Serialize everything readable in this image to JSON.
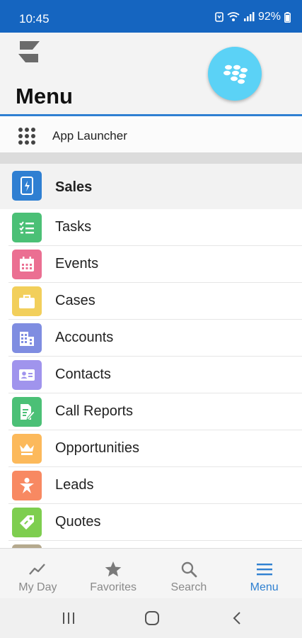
{
  "status_bar": {
    "time": "10:45",
    "battery": "92%",
    "icons": [
      "nfc-icon",
      "wifi-icon",
      "signal-icon",
      "battery-icon"
    ]
  },
  "header": {
    "title": "Menu",
    "logo_icon": "s-logo-icon",
    "fab_icon": "blackberry-logo-icon",
    "fab_color": "#5bd2f6"
  },
  "app_launcher": {
    "label": "App Launcher",
    "icon": "grid-dots-icon"
  },
  "menu": {
    "section": {
      "label": "Sales",
      "icon": "phone-bolt-icon",
      "color": "#2f7fd2"
    },
    "items": [
      {
        "label": "Tasks",
        "icon": "checklist-icon",
        "color": "#4bc076"
      },
      {
        "label": "Events",
        "icon": "calendar-icon",
        "color": "#eb6f92"
      },
      {
        "label": "Cases",
        "icon": "briefcase-icon",
        "color": "#f2cf5b"
      },
      {
        "label": "Accounts",
        "icon": "building-icon",
        "color": "#7f8de1"
      },
      {
        "label": "Contacts",
        "icon": "contact-card-icon",
        "color": "#a094ed"
      },
      {
        "label": "Call Reports",
        "icon": "report-edit-icon",
        "color": "#4bc076"
      },
      {
        "label": "Opportunities",
        "icon": "crown-icon",
        "color": "#fcb95b"
      },
      {
        "label": "Leads",
        "icon": "person-star-icon",
        "color": "#f88962"
      },
      {
        "label": "Quotes",
        "icon": "tag-icon",
        "color": "#7ece4f"
      }
    ],
    "partial_item_color": "#b5a98e"
  },
  "tab_bar": {
    "tabs": [
      {
        "label": "My Day",
        "icon": "trend-line-icon",
        "active": false
      },
      {
        "label": "Favorites",
        "icon": "star-icon",
        "active": false
      },
      {
        "label": "Search",
        "icon": "search-icon",
        "active": false
      },
      {
        "label": "Menu",
        "icon": "hamburger-icon",
        "active": true
      }
    ],
    "active_color": "#2f80d1"
  },
  "nav_bar": {
    "buttons": [
      "recent-apps-icon",
      "home-icon",
      "back-icon"
    ]
  }
}
